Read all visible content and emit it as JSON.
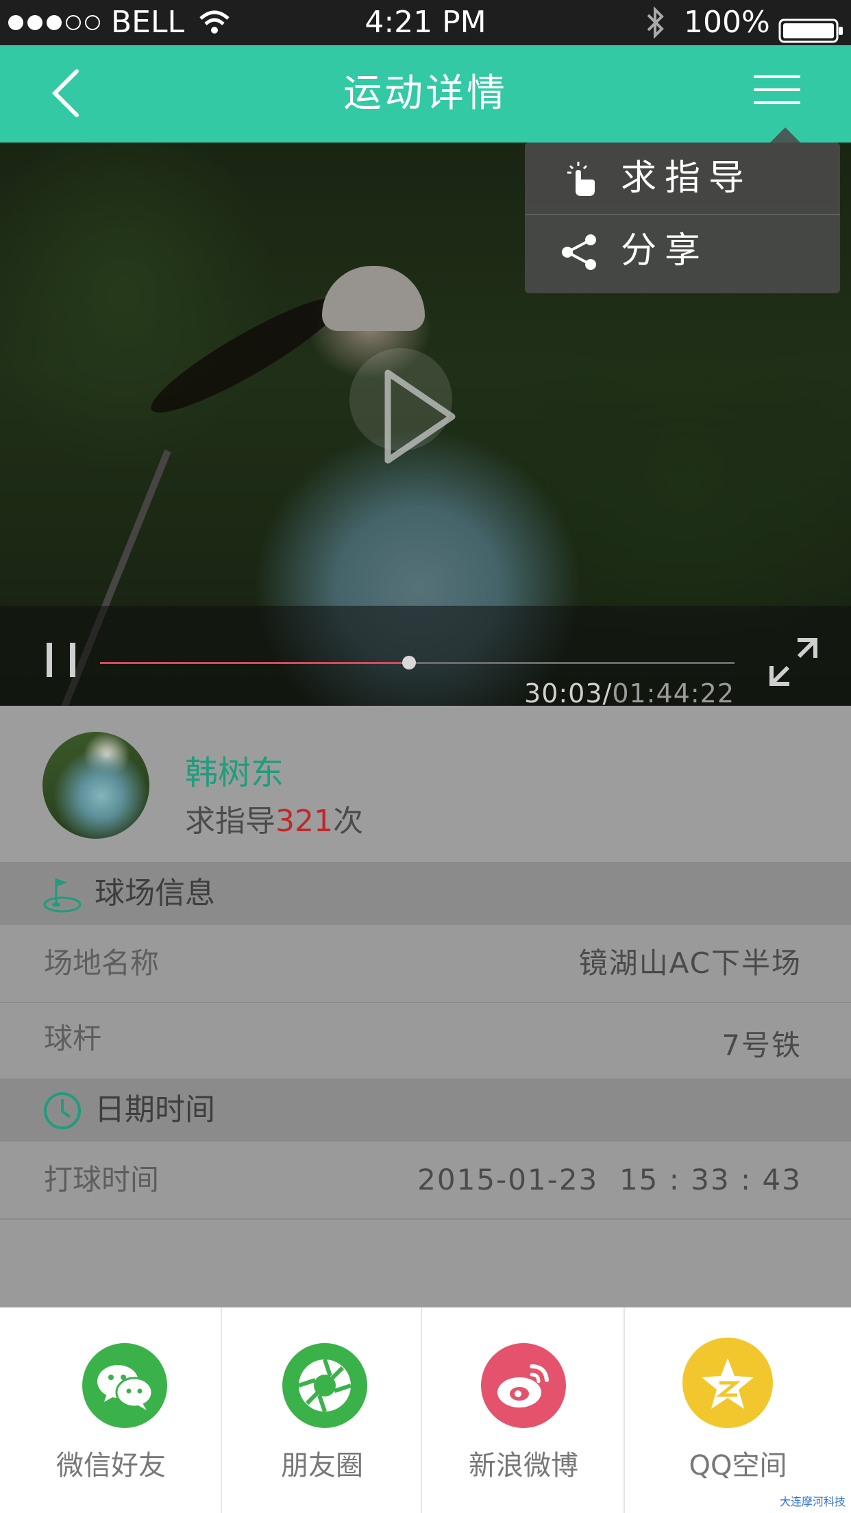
{
  "status_bar": {
    "carrier": "BELL",
    "time": "4:21 PM",
    "battery": "100%"
  },
  "nav": {
    "title": "运动详情",
    "back_icon": "chevron-left-icon",
    "menu_icon": "hamburger-menu-icon"
  },
  "popup_menu": {
    "items": [
      {
        "label": "求指导",
        "icon": "hand-tap-icon"
      },
      {
        "label": "分享",
        "icon": "share-icon"
      }
    ]
  },
  "video": {
    "current_time": "30:03/",
    "total_time": "01:44:22",
    "progress": 0.487,
    "progress_color": "#d9485a"
  },
  "user": {
    "name": "韩树东",
    "count_prefix": "求指导",
    "count": "321",
    "count_suffix": "次"
  },
  "course_section": {
    "title": "球场信息",
    "icon": "golf-flag-icon",
    "rows": [
      {
        "key": "场地名称",
        "value": "镜湖山AC下半场"
      },
      {
        "key": "球杆",
        "value": "7号铁"
      }
    ]
  },
  "date_section": {
    "title": "日期时间",
    "icon": "clock-icon",
    "rows": [
      {
        "key": "打球时间",
        "value": "2015-01-23  15 : 33 : 43"
      }
    ]
  },
  "share": {
    "items": [
      {
        "label": "微信好友",
        "icon": "wechat-icon",
        "color": "#3bb14a"
      },
      {
        "label": "朋友圈",
        "icon": "moments-icon",
        "color": "#3bb14a"
      },
      {
        "label": "新浪微博",
        "icon": "weibo-icon",
        "color": "#e4536b"
      },
      {
        "label": "QQ空间",
        "icon": "qzone-icon",
        "color": "#f2c72d"
      }
    ]
  },
  "accent": "#33c9a5",
  "watermark": "大连摩河科技"
}
